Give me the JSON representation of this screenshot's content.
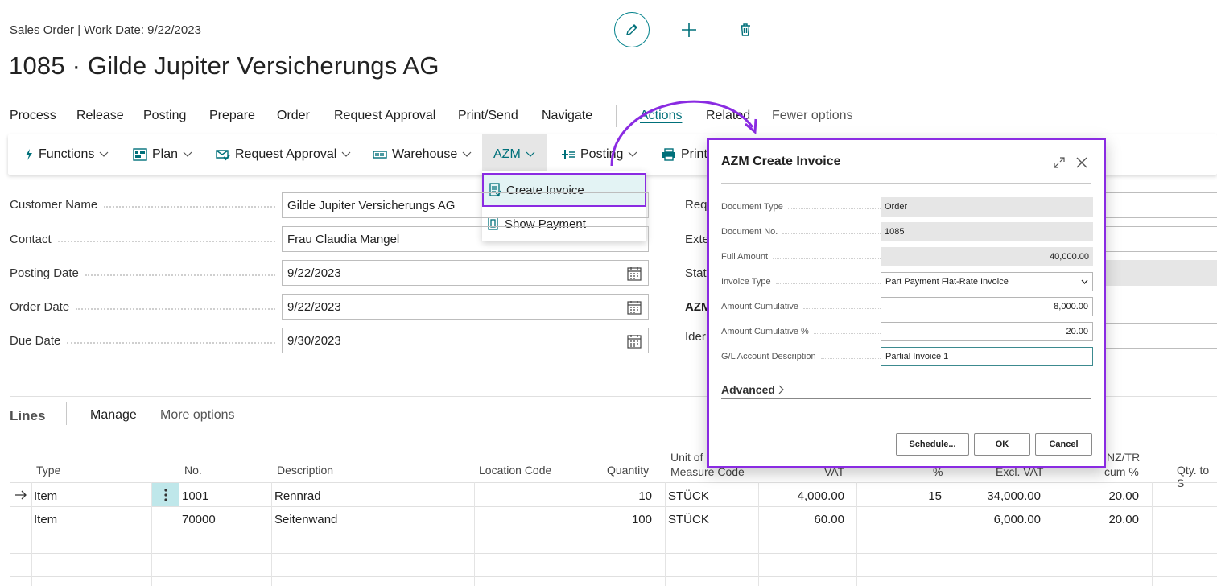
{
  "header": {
    "breadcrumb": "Sales Order | Work Date: 9/22/2023",
    "title": "1085 · Gilde Jupiter Versicherungs AG",
    "icons": [
      "pencil-icon",
      "plus-icon",
      "trash-icon"
    ]
  },
  "actions": {
    "items": [
      "Process",
      "Release",
      "Posting",
      "Prepare",
      "Order",
      "Request Approval",
      "Print/Send",
      "Navigate"
    ],
    "active": "Actions",
    "related": "Related",
    "fewer": "Fewer options"
  },
  "ribbon": {
    "functions": "Functions",
    "plan": "Plan",
    "request_approval": "Request Approval",
    "warehouse": "Warehouse",
    "azm": "AZM",
    "posting": "Posting",
    "print": "Print"
  },
  "azm_menu": {
    "create_invoice": "Create Invoice",
    "show_payment": "Show Payment"
  },
  "form": {
    "customer_name_label": "Customer Name",
    "customer_name": "Gilde Jupiter Versicherungs AG",
    "contact_label": "Contact",
    "contact": "Frau Claudia Mangel",
    "posting_date_label": "Posting Date",
    "posting_date": "9/22/2023",
    "order_date_label": "Order Date",
    "order_date": "9/22/2023",
    "due_date_label": "Due Date",
    "due_date": "9/30/2023",
    "right_labels": [
      "Req",
      "Exte",
      "Stat",
      "AZM",
      "Ider"
    ]
  },
  "lines": {
    "title": "Lines",
    "manage": "Manage",
    "more": "More options",
    "columns": {
      "type": "Type",
      "no": "No.",
      "description": "Description",
      "location": "Location Code",
      "quantity": "Quantity",
      "uom_1": "Unit of",
      "uom_2": "Measure Code",
      "vat": "VAT",
      "pct": "%",
      "excl_vat": "Excl. VAT",
      "nztr": "NZ/TR",
      "cum_pct": "cum %",
      "qty_to": "Qty. to S"
    },
    "rows": [
      {
        "type": "Item",
        "no": "1001",
        "description": "Rennrad",
        "quantity": "10",
        "uom": "STÜCK",
        "vat": "4,000.00",
        "pct": "15",
        "excl": "34,000.00",
        "cum": "20.00"
      },
      {
        "type": "Item",
        "no": "70000",
        "description": "Seitenwand",
        "quantity": "100",
        "uom": "STÜCK",
        "vat": "60.00",
        "pct": "",
        "excl": "6,000.00",
        "cum": "20.00"
      }
    ]
  },
  "dialog": {
    "title": "AZM Create Invoice",
    "fields": {
      "document_type_label": "Document Type",
      "document_type": "Order",
      "document_no_label": "Document No.",
      "document_no": "1085",
      "full_amount_label": "Full Amount",
      "full_amount": "40,000.00",
      "invoice_type_label": "Invoice Type",
      "invoice_type": "Part Payment Flat-Rate Invoice",
      "amount_cum_label": "Amount Cumulative",
      "amount_cum": "8,000.00",
      "amount_cum_pct_label": "Amount Cumulative %",
      "amount_cum_pct": "20.00",
      "gl_desc_label": "G/L Account Description",
      "gl_desc": "Partial Invoice 1"
    },
    "advanced": "Advanced",
    "buttons": {
      "schedule": "Schedule...",
      "ok": "OK",
      "cancel": "Cancel"
    }
  },
  "colors": {
    "accent": "#00707a",
    "highlight": "#8a2be2"
  }
}
